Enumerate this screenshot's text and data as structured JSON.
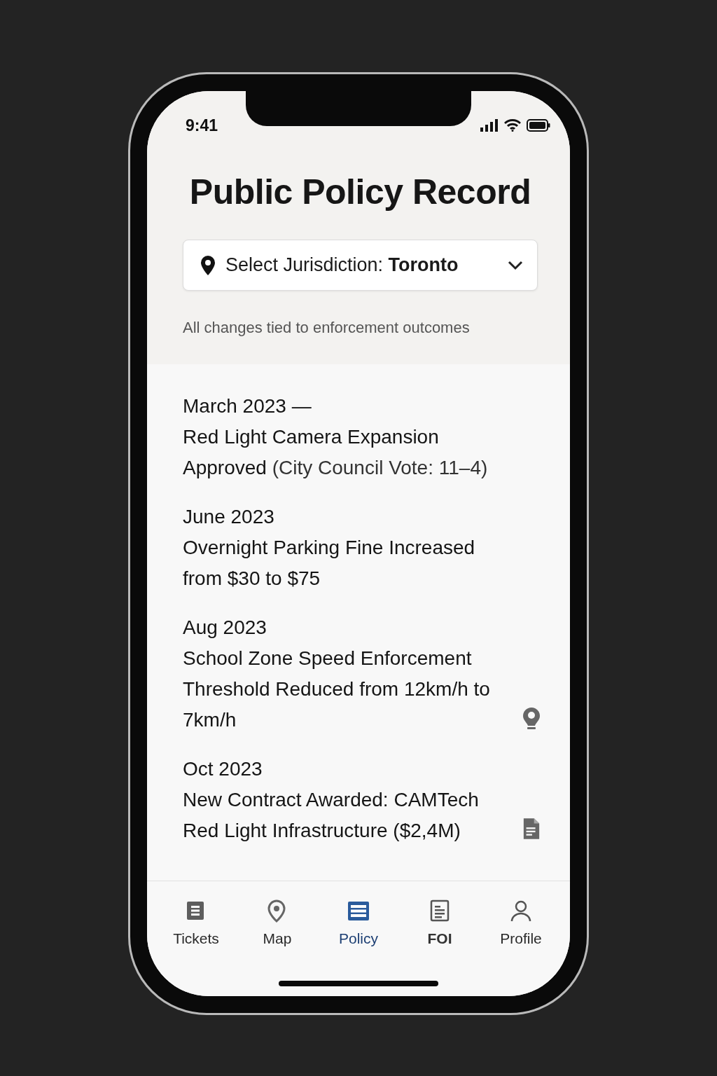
{
  "status_bar": {
    "time": "9:41"
  },
  "title": "Public Policy Record",
  "jurisdiction_select": {
    "label": "Select Jurisdiction:",
    "value": "Toronto"
  },
  "subtitle": "All changes tied to enforcement outcomes",
  "entries": [
    {
      "date": "March 2023 —",
      "text": "Red Light Camera Expansion Approved",
      "detail": "(City Council Vote: 11–4)",
      "kind": "plain"
    },
    {
      "date": "June 2023",
      "text": "Overnight Parking Fine Increased from $30 to $75",
      "kind": "plain"
    },
    {
      "date": "Aug 2023",
      "text": "School Zone Speed Enforcement Threshold Reduced from 12km/h to 7km/h",
      "kind": "location"
    },
    {
      "date": "Oct 2023",
      "text": "New Contract Awarded: CAMTech Red Light Infrastructure ($2,4M)",
      "kind": "document"
    }
  ],
  "tabs": [
    {
      "label": "Tickets",
      "kind": "tickets",
      "selected": false,
      "emphasized": false
    },
    {
      "label": "Map",
      "kind": "map",
      "selected": false,
      "emphasized": false
    },
    {
      "label": "Policy",
      "kind": "policy",
      "selected": true,
      "emphasized": false
    },
    {
      "label": "FOI",
      "kind": "foi",
      "selected": false,
      "emphasized": true
    },
    {
      "label": "Profile",
      "kind": "profile",
      "selected": false,
      "emphasized": false
    }
  ]
}
